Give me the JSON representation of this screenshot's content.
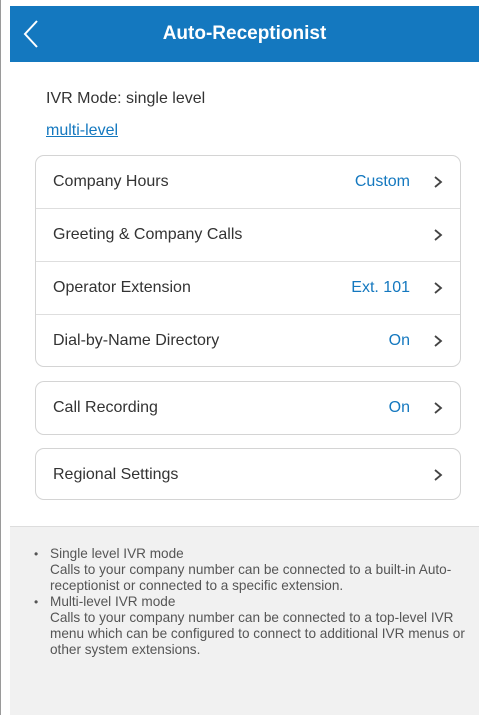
{
  "header": {
    "title": "Auto-Receptionist",
    "back_icon": "chevron-left-icon"
  },
  "mode": {
    "current_label": "IVR Mode: single level",
    "alternate_link": "multi-level"
  },
  "settings_group": [
    {
      "label": "Company Hours",
      "value": "Custom"
    },
    {
      "label": "Greeting & Company Calls",
      "value": ""
    },
    {
      "label": "Operator Extension",
      "value": "Ext. 101"
    },
    {
      "label": "Dial-by-Name Directory",
      "value": "On"
    }
  ],
  "call_recording": {
    "label": "Call Recording",
    "value": "On"
  },
  "regional_settings": {
    "label": "Regional Settings"
  },
  "notes": [
    {
      "title": "Single level IVR mode",
      "body": "Calls to your company number can be connected to a built-in Auto-receptionist or connected to a specific extension."
    },
    {
      "title": "Multi-level IVR mode",
      "body": "Calls to your company number can be connected to a top-level IVR menu which can be configured to connect to additional IVR menus or other system extensions."
    }
  ],
  "colors": {
    "header_bg": "#1478bf",
    "accent": "#1478bf",
    "footer_bg": "#f1f1f1"
  }
}
